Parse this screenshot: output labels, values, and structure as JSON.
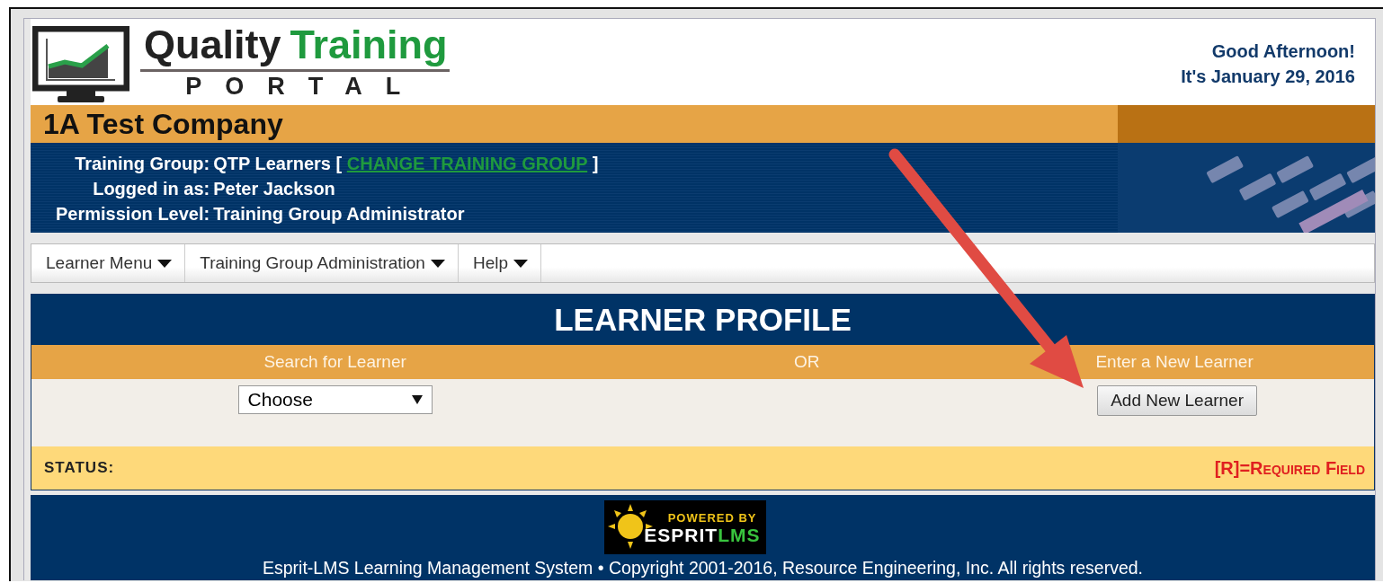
{
  "header": {
    "logo": {
      "word1": "Quality",
      "word2": "Training",
      "subtitle": "PORTAL"
    },
    "greeting": "Good Afternoon!",
    "date": "It's January 29, 2016"
  },
  "company": "1A Test Company",
  "info": [
    {
      "label": "Training Group:",
      "value": "QTP Learners [",
      "link": "CHANGE TRAINING GROUP",
      "after": "]"
    },
    {
      "label": "Logged in as:",
      "value": "Peter Jackson"
    },
    {
      "label": "Permission Level:",
      "value": "Training Group Administrator"
    }
  ],
  "menu": [
    {
      "label": "Learner Menu"
    },
    {
      "label": "Training Group Administration"
    },
    {
      "label": "Help"
    }
  ],
  "profile": {
    "title": "LEARNER PROFILE",
    "columns": [
      "Search for Learner",
      "OR",
      "Enter a New Learner"
    ],
    "select": {
      "value": "Choose"
    },
    "button": "Add New Learner",
    "status_label": "STATUS:",
    "required_note": "[R]=Required Field"
  },
  "footer": {
    "badge": {
      "top": "POWERED BY",
      "brand": "ESPRIT",
      "brand2": "LMS"
    },
    "copyright": "Esprit-LMS Learning Management System • Copyright 2001-2016, Resource Engineering, Inc. All rights reserved."
  }
}
